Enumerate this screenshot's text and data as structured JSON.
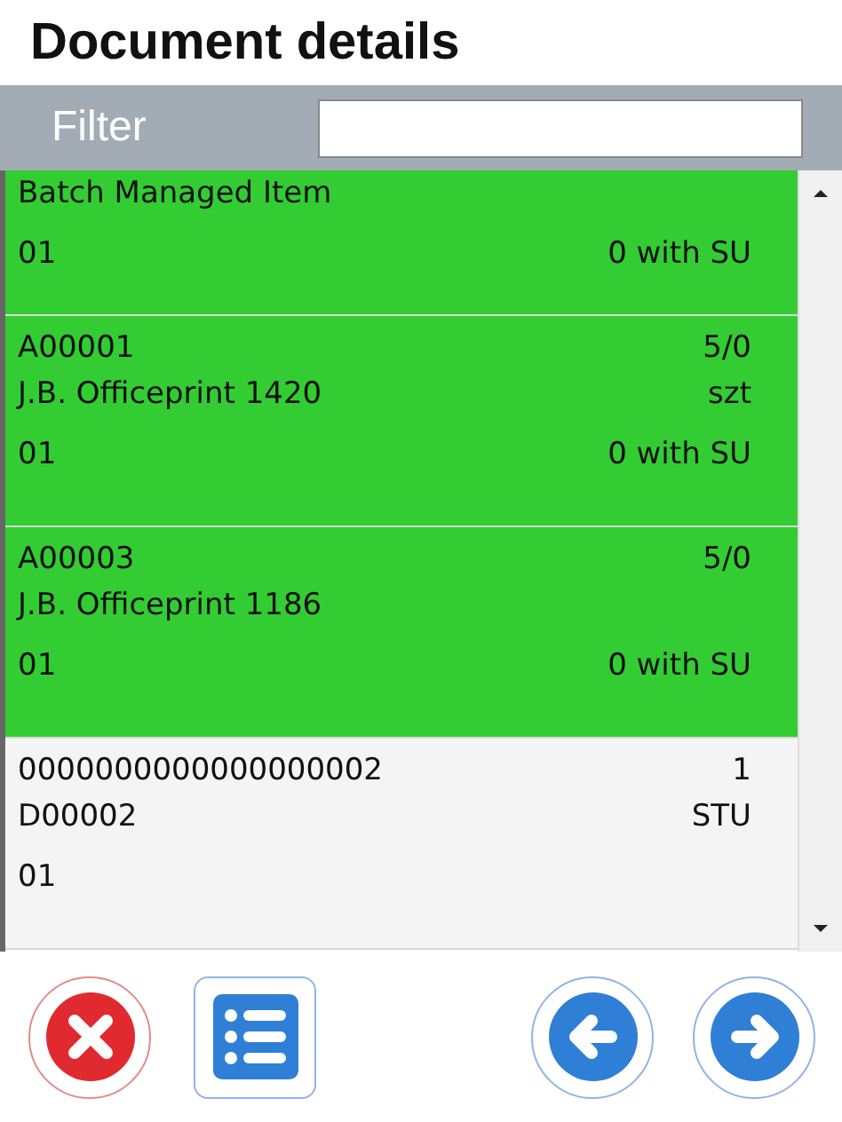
{
  "title": "Document details",
  "filter": {
    "label": "Filter"
  },
  "rows": [
    {
      "name": "Batch Managed Item",
      "batch": "01",
      "su": "0 with SU",
      "completed": true,
      "partial": true
    },
    {
      "code": "A00001",
      "qty": "5/0",
      "name": "J.B. Officeprint 1420",
      "unit": "szt",
      "batch": "01",
      "su": "0 with SU",
      "completed": true,
      "partial": false
    },
    {
      "code": "A00003",
      "qty": "5/0",
      "name": "J.B. Officeprint 1186",
      "batch": "01",
      "su": "0 with SU",
      "completed": true,
      "partial": false
    },
    {
      "code": "0000000000000000002",
      "qty": "1",
      "name": "D00002",
      "unit": "STU",
      "batch": "01",
      "completed": false,
      "partial": false
    }
  ]
}
